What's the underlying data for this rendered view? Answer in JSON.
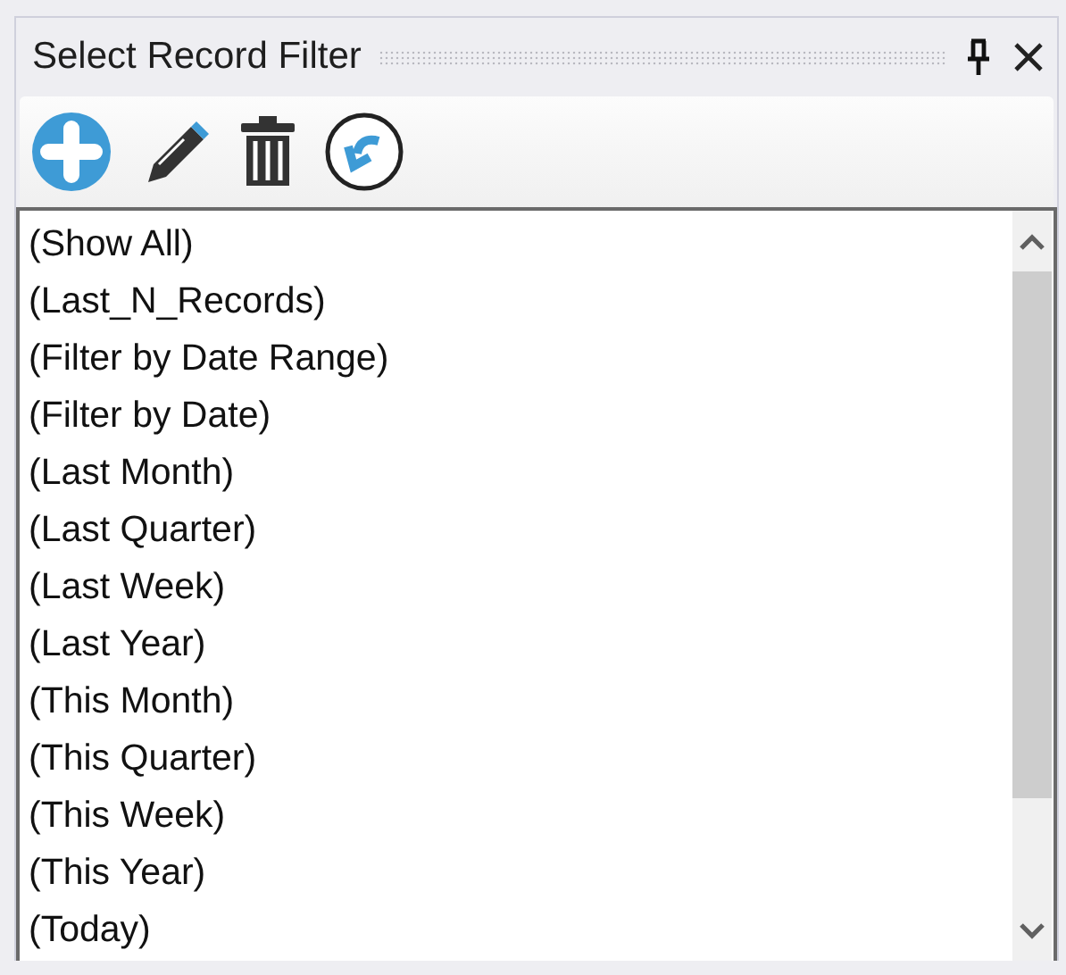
{
  "panel": {
    "title": "Select Record Filter"
  },
  "items": [
    {
      "label": "(Show All)"
    },
    {
      "label": "(Last_N_Records)"
    },
    {
      "label": "(Filter by Date Range)"
    },
    {
      "label": "(Filter by Date)"
    },
    {
      "label": "(Last Month)"
    },
    {
      "label": "(Last Quarter)"
    },
    {
      "label": "(Last Week)"
    },
    {
      "label": "(Last Year)"
    },
    {
      "label": "(This Month)"
    },
    {
      "label": "(This Quarter)"
    },
    {
      "label": "(This Week)"
    },
    {
      "label": "(This Year)"
    },
    {
      "label": "(Today)"
    }
  ]
}
